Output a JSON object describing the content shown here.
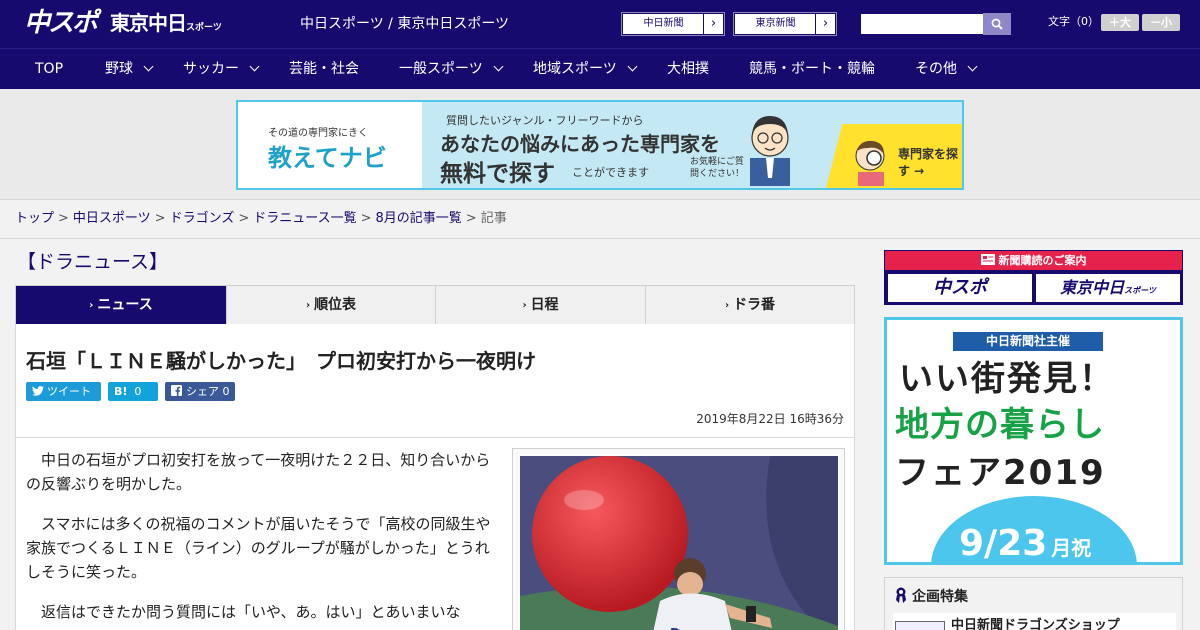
{
  "header": {
    "logo_main": "中スポ",
    "logo_tokyo": "東京中日",
    "logo_tokyo_suffix": "スポーツ",
    "site_name": "中日スポーツ / 東京中日スポーツ",
    "paper_links": [
      {
        "label": "中日新聞",
        "arrow": "›"
      },
      {
        "label": "東京新聞",
        "arrow": "›"
      }
    ],
    "search": {
      "placeholder": ""
    },
    "font_size": {
      "label": "文字（0）",
      "increase": "＋大",
      "decrease": "－小"
    }
  },
  "nav": {
    "items": [
      {
        "label": "TOP"
      },
      {
        "label": "野球"
      },
      {
        "label": "サッカー"
      },
      {
        "label": "芸能・社会"
      },
      {
        "label": "一般スポーツ"
      },
      {
        "label": "地域スポーツ"
      },
      {
        "label": "大相撲"
      },
      {
        "label": "競馬・ボート・競輪"
      },
      {
        "label": "その他"
      }
    ]
  },
  "ad_banner": {
    "brand_small": "その道の専門家にきく",
    "brand_big": "教えてナビ",
    "line1": "質問したいジャンル・フリーワードから",
    "line2": "あなたの悩みにあった専門家を",
    "line3": "無料で探す",
    "line4": "ことができます",
    "line5": "お気軽にご質問ください！",
    "cta": "専門家を探す →"
  },
  "breadcrumb": {
    "items": [
      "トップ",
      "中日スポーツ",
      "ドラゴンズ",
      "ドラニュース一覧",
      "8月の記事一覧"
    ],
    "separator": ">",
    "current": "記事"
  },
  "section": {
    "title": "【ドラニュース】"
  },
  "tabs": [
    {
      "label": "ニュース",
      "marker": "›"
    },
    {
      "label": "順位表",
      "marker": "›"
    },
    {
      "label": "日程",
      "marker": "›"
    },
    {
      "label": "ドラ番",
      "marker": "›"
    }
  ],
  "article": {
    "headline": "石垣「ＬＩＮＥ騒がしかった」　プロ初安打から一夜明け",
    "share": {
      "tweet": "ツイート",
      "hatena_label": "B!",
      "hatena_count": "0",
      "facebook_label": "シェア",
      "facebook_count": "0"
    },
    "date": "2019年8月22日 16時36分",
    "paragraphs": [
      "中日の石垣がプロ初安打を放って一夜明けた２２日、知り合いからの反響ぶりを明かした。",
      "スマホには多くの祝福のコメントが届いたそうで「高校の同級生や家族でつくるＬＩＮＥ（ライン）のグループが騒がしかった」とうれしそうに笑った。",
      "返信はできたか問う質問には「いや、あ。はい」とあいまいな"
    ]
  },
  "sidebar": {
    "subscribe": {
      "heading": "新聞購読のご案内",
      "option_main": "中スポ",
      "option_tokyo": "東京中日",
      "option_tokyo_suffix": "スポーツ"
    },
    "fair": {
      "organizer": "中日新聞社主催",
      "line1": "いい街発見！",
      "line2": "地方の暮らし",
      "line3": "フェア2019",
      "date": "9/23",
      "date_suffix": "月祝"
    },
    "feature": {
      "heading": "企画特集",
      "item": "中日新聞ドラゴンズショップ"
    }
  },
  "colors": {
    "brand_navy": "#170a6e",
    "accent_red": "#e4224c",
    "accent_cyan": "#50c6e8",
    "twitter": "#1d9bd9",
    "facebook": "#3b5898"
  }
}
